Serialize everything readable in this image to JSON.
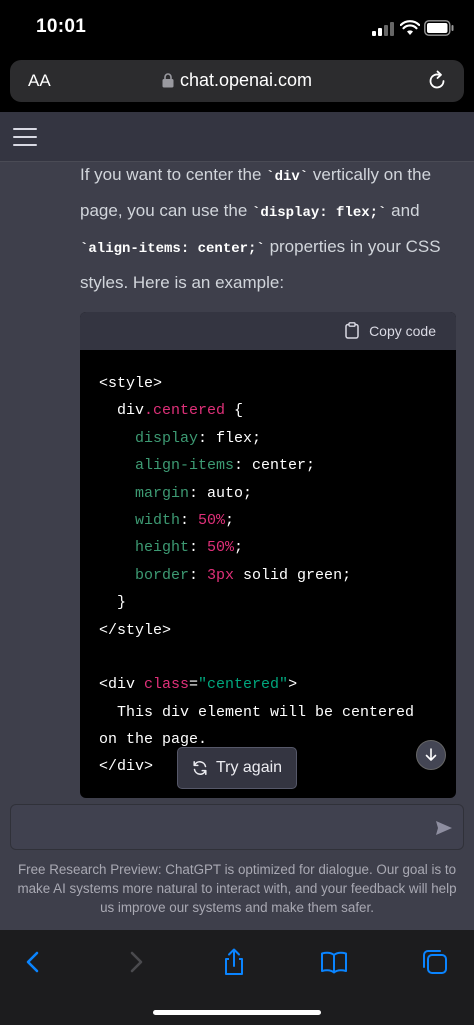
{
  "status_bar": {
    "time": "10:01"
  },
  "browser": {
    "text_size_label": "AA",
    "url": "chat.openai.com"
  },
  "chat": {
    "answer_segments": [
      {
        "text": "If you want to center the ",
        "code": false
      },
      {
        "text": "`div`",
        "code": true
      },
      {
        "text": " vertically on the page, you can use the ",
        "code": false
      },
      {
        "text": "`display: flex;`",
        "code": true
      },
      {
        "text": " and ",
        "code": false
      },
      {
        "text": "`align-items: center;`",
        "code": true
      },
      {
        "text": " properties in your CSS styles. Here is an example:",
        "code": false
      }
    ],
    "copy_code_label": "Copy code",
    "code_lines": [
      [
        {
          "t": "<style>",
          "c": ""
        }
      ],
      [
        {
          "t": "  div",
          "c": ""
        },
        {
          "t": ".centered",
          "c": "c-red"
        },
        {
          "t": " {",
          "c": ""
        }
      ],
      [
        {
          "t": "    display",
          "c": "c-prop"
        },
        {
          "t": ": flex;",
          "c": ""
        }
      ],
      [
        {
          "t": "    align-items",
          "c": "c-prop"
        },
        {
          "t": ": center;",
          "c": ""
        }
      ],
      [
        {
          "t": "    margin",
          "c": "c-prop"
        },
        {
          "t": ": auto;",
          "c": ""
        }
      ],
      [
        {
          "t": "    width",
          "c": "c-prop"
        },
        {
          "t": ": ",
          "c": ""
        },
        {
          "t": "50%",
          "c": "c-red"
        },
        {
          "t": ";",
          "c": ""
        }
      ],
      [
        {
          "t": "    height",
          "c": "c-prop"
        },
        {
          "t": ": ",
          "c": ""
        },
        {
          "t": "50%",
          "c": "c-red"
        },
        {
          "t": ";",
          "c": ""
        }
      ],
      [
        {
          "t": "    border",
          "c": "c-prop"
        },
        {
          "t": ": ",
          "c": ""
        },
        {
          "t": "3px",
          "c": "c-red"
        },
        {
          "t": " solid green;",
          "c": ""
        }
      ],
      [
        {
          "t": "  }",
          "c": ""
        }
      ],
      [
        {
          "t": "</style>",
          "c": ""
        }
      ],
      [
        {
          "t": "",
          "c": ""
        }
      ],
      [
        {
          "t": "<div ",
          "c": ""
        },
        {
          "t": "class",
          "c": "c-red"
        },
        {
          "t": "=",
          "c": ""
        },
        {
          "t": "\"centered\"",
          "c": "c-str"
        },
        {
          "t": ">",
          "c": ""
        }
      ],
      [
        {
          "t": "  This div element will be centered",
          "c": ""
        }
      ],
      [
        {
          "t": "on the page.",
          "c": ""
        }
      ],
      [
        {
          "t": "</div>",
          "c": ""
        }
      ]
    ],
    "try_again_label": "Try again",
    "input_placeholder": "",
    "disclaimer": "Free Research Preview: ChatGPT is optimized for dialogue. Our goal is to make AI systems more natural to interact with, and your feedback will help us improve our systems and make them safer."
  },
  "colors": {
    "page_bg": "#3e3f4b",
    "topbar_bg": "#343541",
    "code_bg": "#000000",
    "safari_accent": "#0a84ff",
    "code_keyword": "#df3079",
    "code_property": "#3d9a73",
    "code_string": "#00a67d"
  },
  "icons": {
    "status": [
      "cellular-signal-icon",
      "wifi-icon",
      "battery-icon"
    ],
    "browser": [
      "lock-icon",
      "reload-icon"
    ],
    "chat": [
      "hamburger-menu-icon",
      "clipboard-icon",
      "refresh-icon",
      "arrow-down-icon",
      "send-icon"
    ],
    "toolbar": [
      "back-icon",
      "forward-icon",
      "share-icon",
      "bookmarks-icon",
      "tabs-icon"
    ]
  }
}
